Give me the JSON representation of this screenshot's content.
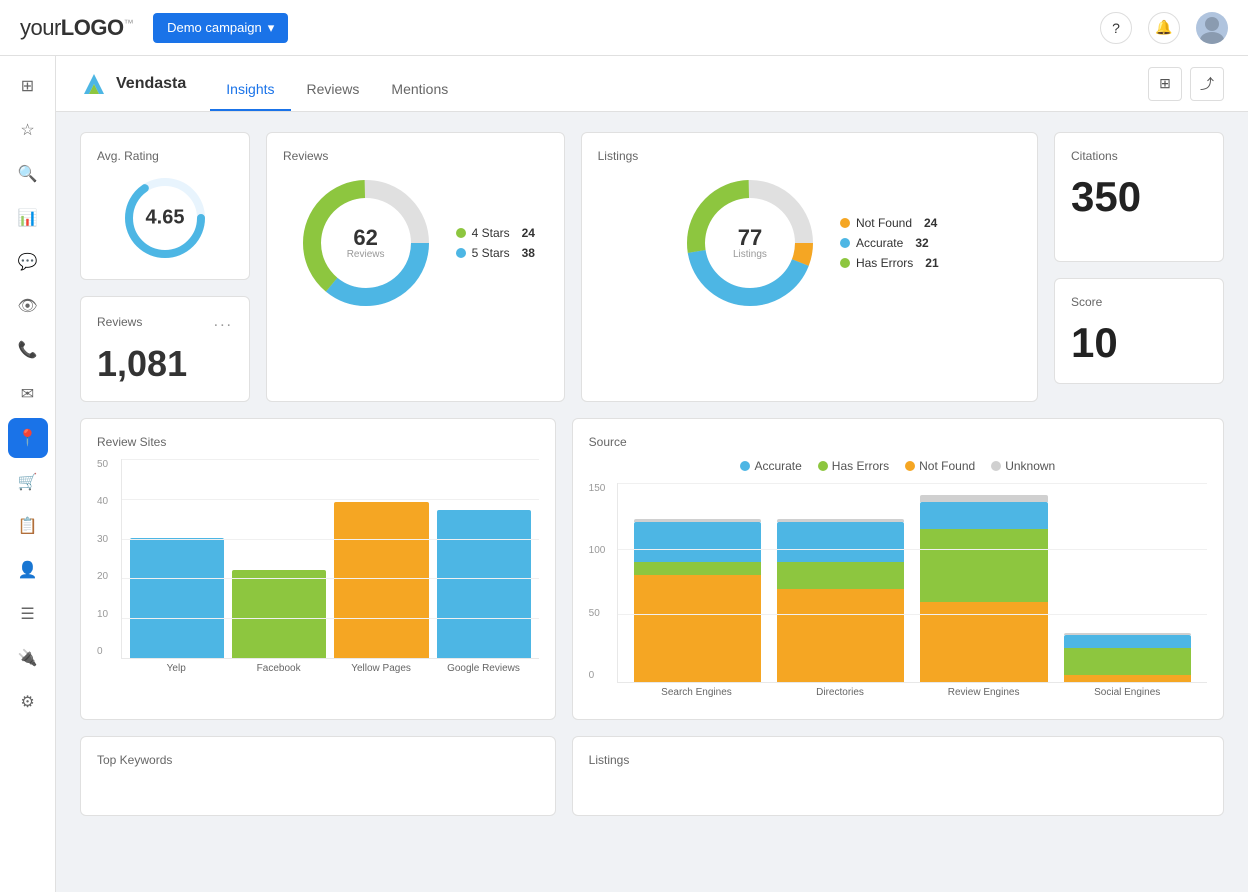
{
  "topNav": {
    "logoText": "your",
    "logoBold": "LOGO",
    "logoTm": "™",
    "campaignLabel": "Demo campaign",
    "helpIcon": "?",
    "bellIcon": "🔔"
  },
  "sidebar": {
    "items": [
      {
        "icon": "⊞",
        "label": "home",
        "active": false
      },
      {
        "icon": "★",
        "label": "favorites",
        "active": false
      },
      {
        "icon": "🔍",
        "label": "search",
        "active": false
      },
      {
        "icon": "📊",
        "label": "dashboard",
        "active": false
      },
      {
        "icon": "💬",
        "label": "messages",
        "active": false
      },
      {
        "icon": "👁",
        "label": "monitor",
        "active": false
      },
      {
        "icon": "📞",
        "label": "phone",
        "active": false
      },
      {
        "icon": "✉",
        "label": "email",
        "active": false
      },
      {
        "icon": "📍",
        "label": "location",
        "active": true
      },
      {
        "icon": "🛒",
        "label": "store",
        "active": false
      },
      {
        "icon": "📋",
        "label": "reports",
        "active": false
      },
      {
        "icon": "👤",
        "label": "users",
        "active": false
      },
      {
        "icon": "☰",
        "label": "list",
        "active": false
      },
      {
        "icon": "🔌",
        "label": "integrations",
        "active": false
      },
      {
        "icon": "⚙",
        "label": "settings",
        "active": false
      }
    ]
  },
  "subHeader": {
    "brandName": "Vendasta",
    "tabs": [
      {
        "label": "Insights",
        "active": true
      },
      {
        "label": "Reviews",
        "active": false
      },
      {
        "label": "Mentions",
        "active": false
      }
    ],
    "columnsIcon": "⊞",
    "shareIcon": "⤴"
  },
  "avgRating": {
    "title": "Avg. Rating",
    "value": "4.65"
  },
  "reviews": {
    "title": "Reviews",
    "total": "62",
    "totalLabel": "Reviews",
    "legend": [
      {
        "label": "4 Stars",
        "count": "24",
        "color": "#8dc63f"
      },
      {
        "label": "5 Stars",
        "count": "38",
        "color": "#4db6e4"
      }
    ]
  },
  "listings": {
    "title": "Listings",
    "total": "77",
    "totalLabel": "Listings",
    "legend": [
      {
        "label": "Not Found",
        "count": "24",
        "color": "#f5a623"
      },
      {
        "label": "Accurate",
        "count": "32",
        "color": "#4db6e4"
      },
      {
        "label": "Has Errors",
        "count": "21",
        "color": "#8dc63f"
      }
    ]
  },
  "citations": {
    "title": "Citations",
    "value": "350"
  },
  "reviewsCount": {
    "title": "Reviews",
    "value": "1,081",
    "dotsLabel": "..."
  },
  "score": {
    "title": "Score",
    "value": "10"
  },
  "reviewSites": {
    "title": "Review Sites",
    "yLabels": [
      "0",
      "10",
      "20",
      "30",
      "40",
      "50"
    ],
    "bars": [
      {
        "label": "Yelp",
        "value": 30,
        "color": "#4db6e4"
      },
      {
        "label": "Facebook",
        "value": 22,
        "color": "#8dc63f"
      },
      {
        "label": "Yellow Pages",
        "value": 39,
        "color": "#f5a623"
      },
      {
        "label": "Google Reviews",
        "value": 37,
        "color": "#4db6e4"
      }
    ],
    "maxValue": 50
  },
  "source": {
    "title": "Source",
    "legend": [
      {
        "label": "Accurate",
        "color": "#4db6e4"
      },
      {
        "label": "Has Errors",
        "color": "#8dc63f"
      },
      {
        "label": "Not Found",
        "color": "#f5a623"
      },
      {
        "label": "Unknown",
        "color": "#d0d0d0"
      }
    ],
    "yLabels": [
      "0",
      "50",
      "100",
      "150"
    ],
    "groups": [
      {
        "label": "Search Engines",
        "segments": [
          {
            "color": "#f5a623",
            "value": 80
          },
          {
            "color": "#8dc63f",
            "value": 10
          },
          {
            "color": "#4db6e4",
            "value": 30
          },
          {
            "color": "#d0d0d0",
            "value": 2
          }
        ],
        "total": 122
      },
      {
        "label": "Directories",
        "segments": [
          {
            "color": "#f5a623",
            "value": 70
          },
          {
            "color": "#8dc63f",
            "value": 20
          },
          {
            "color": "#4db6e4",
            "value": 30
          },
          {
            "color": "#d0d0d0",
            "value": 2
          }
        ],
        "total": 122
      },
      {
        "label": "Review Engines",
        "segments": [
          {
            "color": "#f5a623",
            "value": 60
          },
          {
            "color": "#8dc63f",
            "value": 55
          },
          {
            "color": "#4db6e4",
            "value": 20
          },
          {
            "color": "#d0d0d0",
            "value": 5
          }
        ],
        "total": 140
      },
      {
        "label": "Social Engines",
        "segments": [
          {
            "color": "#f5a623",
            "value": 5
          },
          {
            "color": "#8dc63f",
            "value": 20
          },
          {
            "color": "#4db6e4",
            "value": 10
          },
          {
            "color": "#d0d0d0",
            "value": 2
          }
        ],
        "total": 37
      }
    ],
    "maxValue": 150
  },
  "topKeywords": {
    "title": "Top Keywords"
  },
  "listingsBottom": {
    "title": "Listings"
  }
}
